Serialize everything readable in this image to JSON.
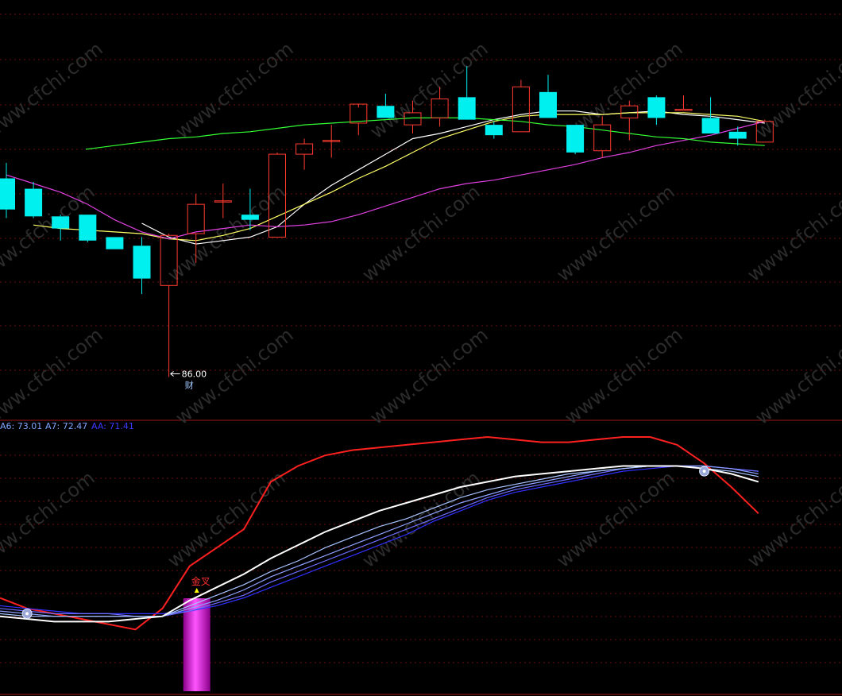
{
  "chart_data": [
    {
      "type": "candlestick",
      "panel": "price",
      "ylim": [
        84.0,
        107.0
      ],
      "grid": true,
      "candles": [
        {
          "o": 97.5,
          "h": 98.4,
          "l": 95.2,
          "c": 95.7
        },
        {
          "o": 96.9,
          "h": 97.3,
          "l": 95.2,
          "c": 95.3
        },
        {
          "o": 95.3,
          "h": 95.4,
          "l": 93.9,
          "c": 94.6
        },
        {
          "o": 95.4,
          "h": 95.4,
          "l": 93.8,
          "c": 93.9
        },
        {
          "o": 94.1,
          "h": 94.1,
          "l": 93.4,
          "c": 93.4
        },
        {
          "o": 93.6,
          "h": 94.1,
          "l": 90.8,
          "c": 91.7
        },
        {
          "o": 91.3,
          "h": 94.3,
          "l": 86.0,
          "c": 94.2
        },
        {
          "o": 94.3,
          "h": 96.6,
          "l": 92.6,
          "c": 96.0
        },
        {
          "o": 96.2,
          "h": 97.2,
          "l": 95.2,
          "c": 96.2
        },
        {
          "o": 95.4,
          "h": 96.9,
          "l": 94.5,
          "c": 95.1
        },
        {
          "o": 94.1,
          "h": 99.0,
          "l": 94.1,
          "c": 98.9
        },
        {
          "o": 98.9,
          "h": 99.8,
          "l": 98.0,
          "c": 99.5
        },
        {
          "o": 99.7,
          "h": 100.6,
          "l": 98.7,
          "c": 99.7
        },
        {
          "o": 100.7,
          "h": 101.6,
          "l": 100.0,
          "c": 101.8
        },
        {
          "o": 101.7,
          "h": 102.4,
          "l": 101.0,
          "c": 101.0
        },
        {
          "o": 100.6,
          "h": 102.0,
          "l": 100.1,
          "c": 101.3
        },
        {
          "o": 101.0,
          "h": 102.8,
          "l": 100.5,
          "c": 102.1
        },
        {
          "o": 102.2,
          "h": 104.0,
          "l": 101.3,
          "c": 100.9
        },
        {
          "o": 100.6,
          "h": 100.8,
          "l": 99.8,
          "c": 100.0
        },
        {
          "o": 100.2,
          "h": 103.2,
          "l": 100.2,
          "c": 102.8
        },
        {
          "o": 102.5,
          "h": 103.5,
          "l": 101.1,
          "c": 101.0
        },
        {
          "o": 100.6,
          "h": 100.6,
          "l": 98.9,
          "c": 99.0
        },
        {
          "o": 99.1,
          "h": 101.1,
          "l": 98.7,
          "c": 100.6
        },
        {
          "o": 101.0,
          "h": 102.0,
          "l": 99.7,
          "c": 101.7
        },
        {
          "o": 102.2,
          "h": 102.3,
          "l": 100.6,
          "c": 101.0
        },
        {
          "o": 101.5,
          "h": 102.3,
          "l": 101.5,
          "c": 101.5
        },
        {
          "o": 101.0,
          "h": 102.2,
          "l": 100.5,
          "c": 100.1
        },
        {
          "o": 100.2,
          "h": 100.5,
          "l": 99.4,
          "c": 99.8
        },
        {
          "o": 99.6,
          "h": 100.9,
          "l": 99.6,
          "c": 100.8
        }
      ],
      "annotations": [
        {
          "text": "86.00",
          "at_candle": 6,
          "value": 86.0
        },
        {
          "text": "财",
          "at_candle": 7
        }
      ],
      "ma_lines": [
        {
          "color": "#ffffff",
          "values": [
            null,
            null,
            null,
            null,
            null,
            94.9,
            94.1,
            93.7,
            93.9,
            94.1,
            94.7,
            96.0,
            97.1,
            98.0,
            98.9,
            99.8,
            100.1,
            100.5,
            100.9,
            101.2,
            101.4,
            101.4,
            101.2,
            101.3,
            101.4,
            101.2,
            101.1,
            100.9,
            100.7
          ]
        },
        {
          "color": "#ffff66",
          "values": [
            null,
            94.8,
            94.6,
            94.5,
            94.4,
            94.3,
            94.0,
            93.9,
            94.2,
            94.6,
            95.3,
            96.0,
            96.7,
            97.5,
            98.2,
            99.0,
            99.8,
            100.3,
            100.8,
            101.1,
            101.2,
            101.2,
            101.2,
            101.3,
            101.3,
            101.3,
            101.2,
            101.1,
            100.8
          ]
        },
        {
          "color": "#e040e0",
          "values": [
            97.7,
            97.2,
            96.7,
            96.0,
            95.1,
            94.4,
            94.0,
            94.4,
            94.6,
            94.8,
            94.7,
            94.8,
            95.0,
            95.4,
            95.9,
            96.4,
            96.9,
            97.2,
            97.4,
            97.7,
            98.0,
            98.3,
            98.7,
            99.0,
            99.4,
            99.7,
            100.0,
            100.4,
            100.8
          ]
        },
        {
          "color": "#33ff33",
          "values": [
            null,
            null,
            null,
            99.2,
            99.4,
            99.6,
            99.8,
            99.9,
            100.1,
            100.2,
            100.4,
            100.6,
            100.7,
            100.8,
            100.9,
            101.0,
            101.0,
            101.0,
            100.9,
            100.8,
            100.6,
            100.5,
            100.3,
            100.1,
            99.9,
            99.8,
            99.6,
            99.5,
            99.4
          ]
        }
      ]
    },
    {
      "type": "line",
      "panel": "indicator",
      "ylim": [
        0,
        100
      ],
      "grid": true,
      "labels": [
        {
          "text": "A6: 73.01",
          "color": "#7da6ff"
        },
        {
          "text": "A7: 72.47",
          "color": "#7da6ff"
        },
        {
          "text": "AA: 71.41",
          "color": "#3a3aff"
        }
      ],
      "signal_text": "金叉",
      "signal_bar": {
        "at_candle": 7,
        "value": 9
      },
      "markers": [
        {
          "at_candle": 1,
          "value": 30
        },
        {
          "at_candle": 26,
          "value": 84
        }
      ],
      "series": [
        {
          "color": "#ff2020",
          "values": [
            36,
            32,
            30,
            28,
            26,
            24,
            32,
            48,
            55,
            62,
            80,
            86,
            90,
            92,
            93,
            94,
            95,
            96,
            97,
            96,
            95,
            95,
            96,
            97,
            97,
            94,
            87,
            78,
            68
          ]
        },
        {
          "color": "#3030ff",
          "values": [
            33,
            32,
            31,
            30,
            30,
            30,
            30,
            31,
            33,
            36,
            40,
            44,
            48,
            52,
            56,
            60,
            65,
            69,
            73,
            76,
            78,
            80,
            82,
            84,
            85,
            86,
            86,
            85,
            84
          ]
        },
        {
          "color": "#6e6eff",
          "values": [
            32,
            31,
            30,
            30,
            30,
            29,
            29,
            31,
            34,
            37,
            42,
            46,
            50,
            54,
            58,
            62,
            66,
            70,
            74,
            77,
            79,
            81,
            83,
            85,
            86,
            86,
            86,
            85,
            84
          ]
        },
        {
          "color": "#8ea2ff",
          "values": [
            31,
            30,
            29,
            29,
            29,
            29,
            29,
            32,
            35,
            39,
            44,
            48,
            52,
            56,
            60,
            64,
            68,
            72,
            75,
            78,
            80,
            82,
            84,
            85,
            86,
            86,
            86,
            85,
            83
          ]
        },
        {
          "color": "#a8c4ff",
          "values": [
            30,
            29,
            29,
            29,
            29,
            29,
            29,
            33,
            37,
            41,
            46,
            50,
            55,
            59,
            63,
            66,
            70,
            74,
            77,
            79,
            81,
            83,
            84,
            85,
            86,
            86,
            85,
            84,
            82
          ]
        },
        {
          "color": "#ffffff",
          "values": [
            29,
            28,
            27,
            27,
            27,
            28,
            29,
            35,
            40,
            45,
            51,
            56,
            61,
            65,
            69,
            72,
            75,
            78,
            80,
            82,
            83,
            84,
            85,
            86,
            86,
            86,
            85,
            83,
            80
          ]
        }
      ]
    }
  ],
  "watermark": "www.cfchi.com"
}
